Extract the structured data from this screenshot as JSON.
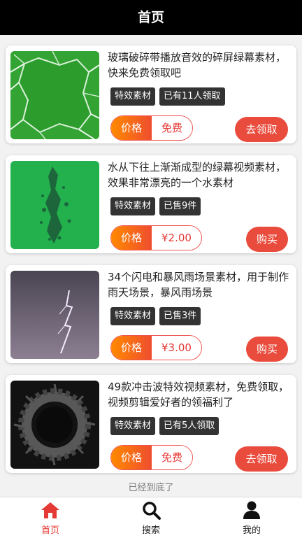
{
  "header": {
    "title": "首页"
  },
  "items": [
    {
      "title": "玻璃破碎带播放音效的碎屏绿幕素材，快来免费领取吧",
      "tags": [
        "特效素材",
        "已有11人领取"
      ],
      "price_label": "价格",
      "price_value": "免费",
      "button": "去领取"
    },
    {
      "title": "水从下往上渐渐成型的绿幕视频素材，效果非常漂亮的一个水素材",
      "tags": [
        "特效素材",
        "已售9件"
      ],
      "price_label": "价格",
      "price_value": "¥2.00",
      "button": "购买"
    },
    {
      "title": "34个闪电和暴风雨场景素材，用于制作雨天场景，暴风雨场景",
      "tags": [
        "特效素材",
        "已售3件"
      ],
      "price_label": "价格",
      "price_value": "¥3.00",
      "button": "购买"
    },
    {
      "title": "49款冲击波特效视频素材，免费领取，视频剪辑爱好者的领福利了",
      "tags": [
        "特效素材",
        "已有5人领取"
      ],
      "price_label": "价格",
      "price_value": "免费",
      "button": "去领取"
    }
  ],
  "footer_note": "已经到底了",
  "tabbar": {
    "home": "首页",
    "search": "搜索",
    "mine": "我的"
  },
  "colors": {
    "accent": "#e94b3c",
    "active_tab": "#e53935",
    "header_bg": "#000000"
  }
}
